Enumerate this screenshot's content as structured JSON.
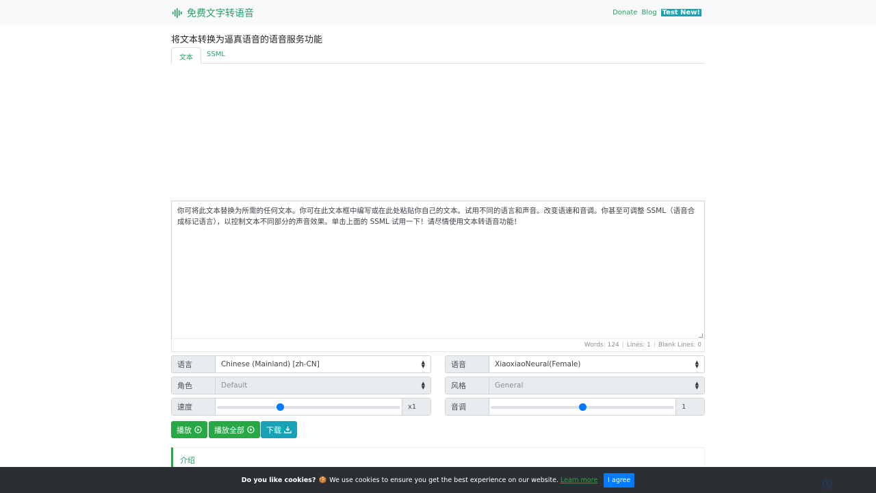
{
  "navbar": {
    "brand": "免费文字转语音",
    "links": {
      "donate": "Donate",
      "blog": "Blog",
      "test_new": "Test New!"
    }
  },
  "page_title": "将文本转换为逼真语音的语音服务功能",
  "tabs": {
    "text": "文本",
    "ssml": "SSML"
  },
  "editor": {
    "text": "你可将此文本替换为所需的任何文本。你可在此文本框中编写或在此处粘贴你自己的文本。试用不同的语言和声音。改变语速和音调。你甚至可调整 SSML（语音合成标记语言），以控制文本不同部分的声音效果。单击上面的 SSML 试用一下！请尽情使用文本转语音功能！"
  },
  "stats": {
    "words": "Words: 124",
    "lines": "Lines: 1",
    "blank_lines": "Blank Lines: 0"
  },
  "controls": {
    "language": {
      "label": "语言",
      "value": "Chinese (Mainland) [zh-CN]"
    },
    "voice": {
      "label": "语音",
      "value": "XiaoxiaoNeural(Female)"
    },
    "role": {
      "label": "角色",
      "value": "Default"
    },
    "style": {
      "label": "风格",
      "value": "General"
    },
    "speed": {
      "label": "速度",
      "value": "x1",
      "level": 0.34
    },
    "pitch": {
      "label": "音调",
      "value": "1",
      "level": 0.5
    }
  },
  "buttons": {
    "play": "播放",
    "play_all": "播放全部",
    "download": "下载"
  },
  "intro": {
    "title": "介绍"
  },
  "cookie": {
    "question": "Do you like cookies?",
    "emoji": "🍪",
    "message": "We use cookies to ensure you get the best experience on our website.",
    "learn_more": "Learn more",
    "agree": "I agree"
  },
  "colors": {
    "brand_green": "#28a065",
    "button_green": "#28a745",
    "teal": "#17a2b8",
    "slider_blue": "#007bff"
  }
}
